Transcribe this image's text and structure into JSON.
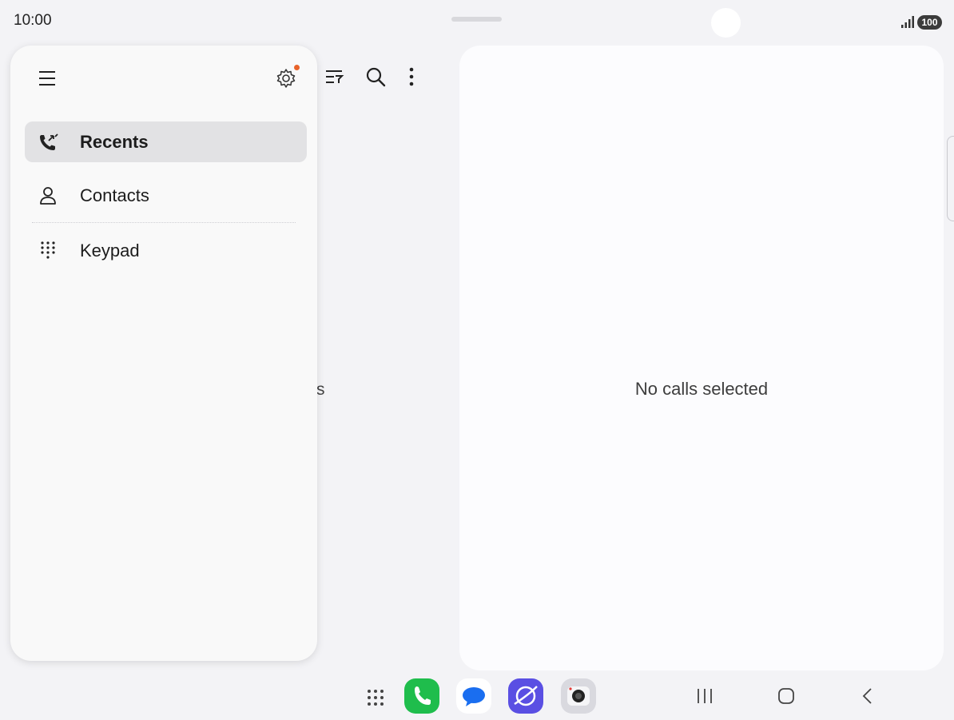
{
  "status_bar": {
    "time": "10:00",
    "battery": "100",
    "signal_icon": "signal-bars-icon"
  },
  "toolbar": {
    "icons": [
      "filter-sort-icon",
      "search-icon",
      "more-options-icon"
    ]
  },
  "background_partial_text": "s",
  "drawer": {
    "menu_icon": "hamburger-menu-icon",
    "settings_icon": "gear-icon",
    "settings_badge_color": "#e8632a",
    "items": [
      {
        "label": "Recents",
        "icon": "recent-calls-icon",
        "selected": true
      },
      {
        "label": "Contacts",
        "icon": "person-icon",
        "selected": false
      },
      {
        "label": "Keypad",
        "icon": "dialpad-icon",
        "selected": false
      }
    ]
  },
  "detail": {
    "empty_message": "No calls selected"
  },
  "taskbar": {
    "apps": [
      {
        "name": "Phone",
        "icon": "phone-app-icon",
        "color": "#1fbd4c"
      },
      {
        "name": "Messages",
        "icon": "messages-app-icon",
        "color": "#1a6ef0"
      },
      {
        "name": "Internet",
        "icon": "internet-app-icon",
        "color": "#5a4fe3"
      },
      {
        "name": "Camera",
        "icon": "camera-app-icon",
        "color": "#d9d9df"
      }
    ],
    "nav_buttons": [
      "recents-nav-icon",
      "home-nav-icon",
      "back-nav-icon"
    ]
  }
}
